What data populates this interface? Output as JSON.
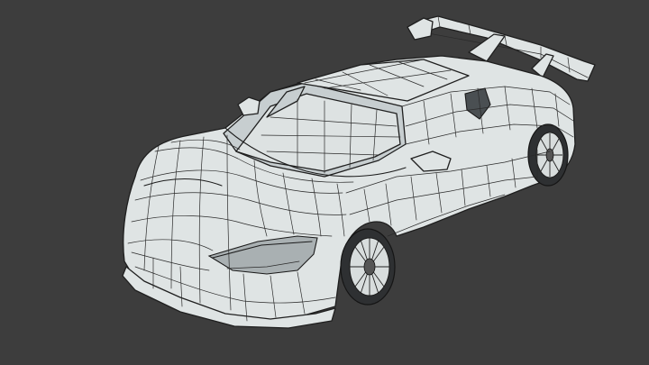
{
  "scene": {
    "background": "#3d3d3d",
    "mesh_fill": "#dfe4e4",
    "wire_color": "#222222",
    "object": "car-wireframe-mesh"
  }
}
